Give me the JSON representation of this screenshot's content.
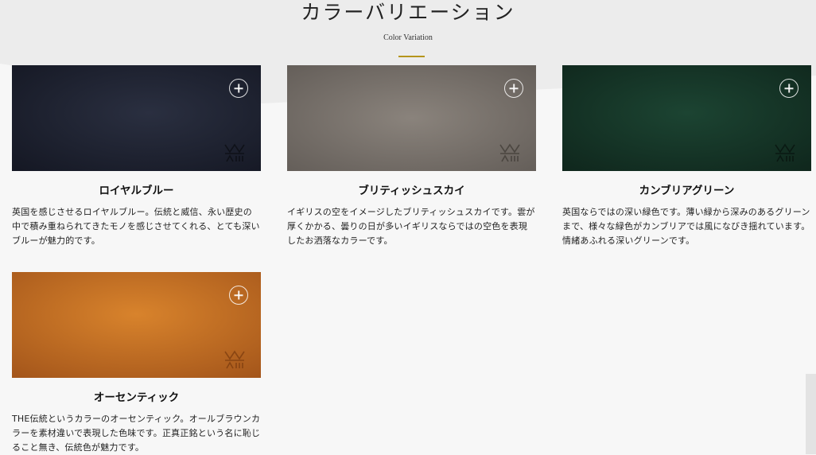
{
  "header": {
    "title": "カラーバリエーション",
    "subtitle": "Color Variation"
  },
  "colors": [
    {
      "name": "ロイヤルブルー",
      "description": "英国を感じさせるロイヤルブルー。伝統と威信、永い歴史の中で積み重ねられてきたモノを感じさせてくれる、とても深いブルーが魅力的です。",
      "swatch_color": "#1e2230"
    },
    {
      "name": "ブリティッシュスカイ",
      "description": "イギリスの空をイメージしたブリティッシュスカイです。雲が厚くかかる、曇りの日が多いイギリスならではの空色を表現したお洒落なカラーです。",
      "swatch_color": "#7d7670"
    },
    {
      "name": "カンブリアグリーン",
      "description": "英国ならではの深い緑色です。薄い緑から深みのあるグリーンまで、様々な緑色がカンブリアでは風になびき揺れています。情緒あふれる深いグリーンです。",
      "swatch_color": "#163528"
    },
    {
      "name": "オーセンティック",
      "description": "THE伝統というカラーのオーセンティック。オールブラウンカラーを素材違いで表現した色味です。正真正銘という名に恥じること無き、伝統色が魅力です。",
      "swatch_color": "#c46a1e"
    }
  ],
  "icons": {
    "expand": "plus-circle-icon",
    "logo": "brand-emboss-logo"
  }
}
